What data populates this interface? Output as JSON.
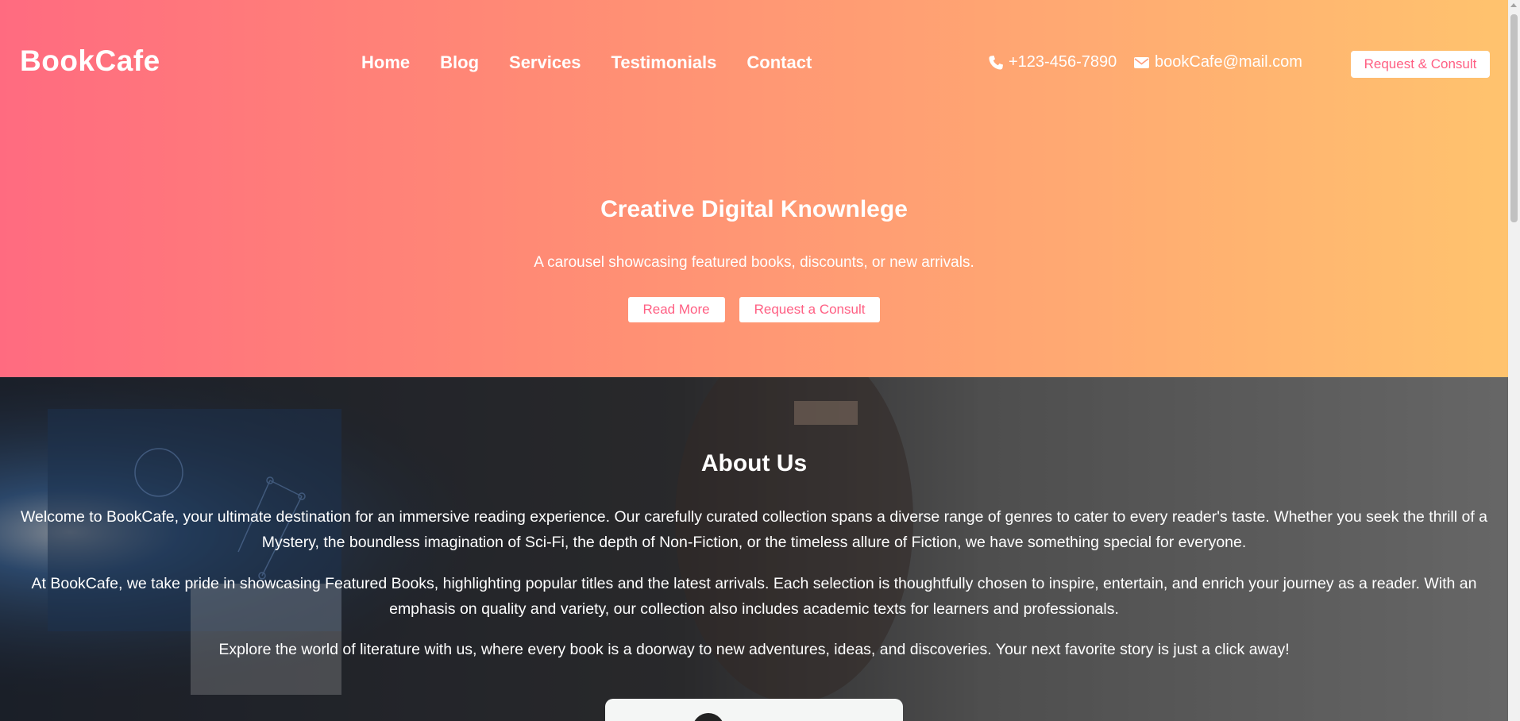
{
  "brand": {
    "name": "BookCafe"
  },
  "nav": {
    "items": [
      "Home",
      "Blog",
      "Services",
      "Testimonials",
      "Contact"
    ]
  },
  "contact": {
    "phone": "+123-456-7890",
    "email": "bookCafe@mail.com",
    "consult_label": "Request & Consult"
  },
  "hero": {
    "title": "Creative Digital Knownlege",
    "subtitle": "A carousel showcasing featured books, discounts, or new arrivals.",
    "read_more_label": "Read More",
    "request_label": "Request a Consult"
  },
  "about": {
    "title": "About Us",
    "p1": "Welcome to BookCafe, your ultimate destination for an immersive reading experience. Our carefully curated collection spans a diverse range of genres to cater to every reader's taste. Whether you seek the thrill of a Mystery, the boundless imagination of Sci-Fi, the depth of Non-Fiction, or the timeless allure of Fiction, we have something special for everyone.",
    "p2": "At BookCafe, we take pride in showcasing Featured Books, highlighting popular titles and the latest arrivals. Each selection is thoughtfully chosen to inspire, entertain, and enrich your journey as a reader. With an emphasis on quality and variety, our collection also includes academic texts for learners and professionals.",
    "p3": "Explore the world of literature with us, where every book is a doorway to new adventures, ideas, and discoveries. Your next favorite story is just a click away!"
  },
  "colors": {
    "gradient_start": "#ff6b80",
    "gradient_end": "#ffc36e",
    "button_text": "#ff5f83"
  }
}
